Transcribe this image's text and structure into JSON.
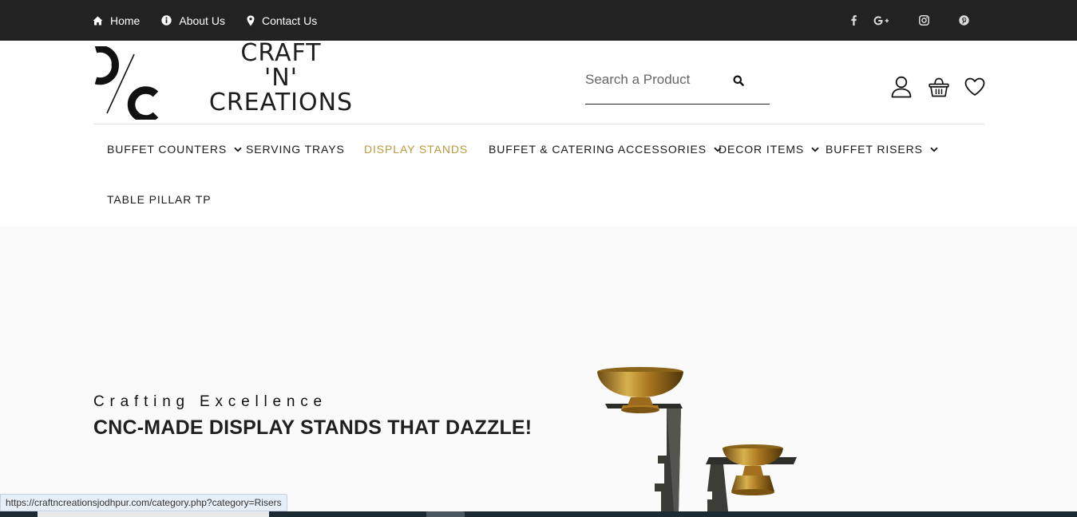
{
  "top_nav": [
    {
      "label": "Home",
      "icon": "home-icon"
    },
    {
      "label": "About Us",
      "icon": "info-icon"
    },
    {
      "label": "Contact Us",
      "icon": "map-marker-icon"
    }
  ],
  "social_icons": [
    "facebook-icon",
    "google-plus-icon",
    "instagram-icon",
    "pinterest-icon"
  ],
  "brand": {
    "line1": "CRAFT",
    "line2": "'N'",
    "line3": "CREATIONS"
  },
  "search": {
    "placeholder": "Search a Product",
    "value": ""
  },
  "header_icons": [
    "user-icon",
    "cart-basket-icon",
    "heart-icon"
  ],
  "menu": [
    {
      "label": "BUFFET COUNTERS",
      "has_dropdown": true,
      "active": false
    },
    {
      "label": "SERVING TRAYS",
      "has_dropdown": false,
      "active": false
    },
    {
      "label": "DISPLAY STANDS",
      "has_dropdown": false,
      "active": true
    },
    {
      "label": "BUFFET & CATERING ACCESSORIES",
      "has_dropdown": true,
      "active": false
    },
    {
      "label": "DECOR ITEMS",
      "has_dropdown": true,
      "active": false
    },
    {
      "label": "BUFFET RISERS",
      "has_dropdown": true,
      "active": false
    },
    {
      "label": "TABLE PILLAR TP",
      "has_dropdown": false,
      "active": false
    }
  ],
  "hero": {
    "subtitle": "Crafting Excellence",
    "title": "CNC-MADE DISPLAY STANDS THAT DAZZLE!"
  },
  "status_url": "https://craftncreationsjodhpur.com/category.php?category=Risers",
  "colors": {
    "topbar_bg": "#222222",
    "accent_gold": "#b99a3e",
    "text_dark": "#1a1a1a",
    "hero_bg": "#fafafa"
  }
}
